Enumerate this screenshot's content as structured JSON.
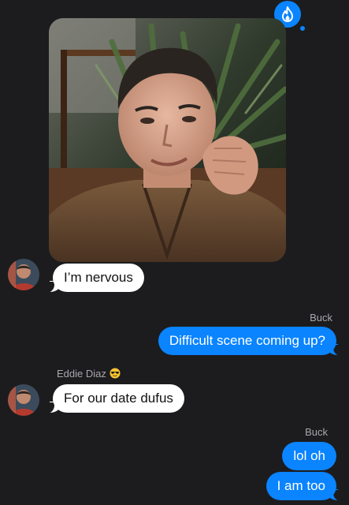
{
  "conversation": {
    "app_icon": "flame-icon",
    "photo": {
      "icon": "photo-selfie"
    },
    "messages": [
      {
        "id": "m1",
        "direction": "incoming",
        "sender": "",
        "text": "I’m nervous"
      },
      {
        "id": "m2",
        "direction": "outgoing",
        "sender": "Buck",
        "text": "Difficult scene coming up?"
      },
      {
        "id": "m3",
        "direction": "incoming",
        "sender": "Eddie Diaz",
        "sender_emoji": "smiling-face-with-sunglasses",
        "text": "For our date dufus"
      },
      {
        "id": "m4",
        "direction": "outgoing",
        "sender": "Buck",
        "text": "lol oh"
      },
      {
        "id": "m5",
        "direction": "outgoing",
        "sender": "",
        "text": "I am too"
      }
    ]
  },
  "colors": {
    "background": "#1c1c1e",
    "outgoing_bubble": "#0a84ff",
    "incoming_bubble": "#ffffff",
    "sender_label": "#a8a8ad"
  }
}
